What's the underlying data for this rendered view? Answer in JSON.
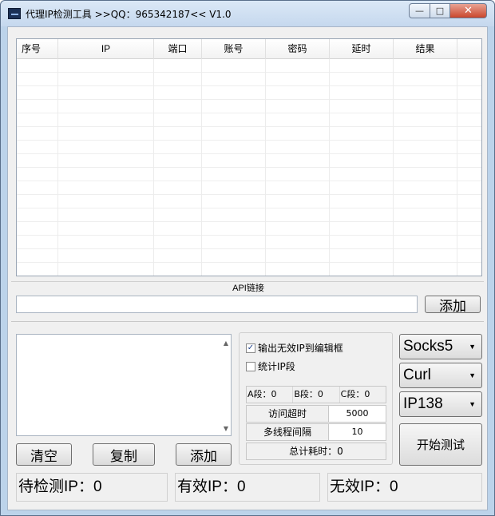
{
  "window": {
    "title": "代理IP检测工具 >>QQ：965342187<< V1.0",
    "controls": {
      "minimize": "—",
      "maximize": "□",
      "close": "✕"
    }
  },
  "table": {
    "columns": [
      "序号",
      "IP",
      "端口",
      "账号",
      "密码",
      "延时",
      "结果"
    ],
    "rows": []
  },
  "api": {
    "label": "API链接",
    "value": "",
    "add_label": "添加"
  },
  "ip_input": {
    "value": ""
  },
  "buttons": {
    "clear": "清空",
    "copy": "复制",
    "add": "添加",
    "start": "开始测试"
  },
  "options": {
    "output_invalid": {
      "label": "输出无效IP到编辑框",
      "checked": true
    },
    "stat_segment": {
      "label": "统计IP段",
      "checked": false
    },
    "segments": {
      "a": "A段：0",
      "b": "B段：0",
      "c": "C段：0"
    },
    "timeout": {
      "label": "访问超时",
      "value": "5000"
    },
    "threads": {
      "label": "多线程间隔",
      "value": "10"
    },
    "total_time": "总计耗时：0"
  },
  "selects": {
    "proxy_type": "Socks5",
    "method": "Curl",
    "check_source": "IP138"
  },
  "status": {
    "pending": "待检测IP：0",
    "valid": "有效IP：0",
    "invalid": "无效IP：0"
  }
}
